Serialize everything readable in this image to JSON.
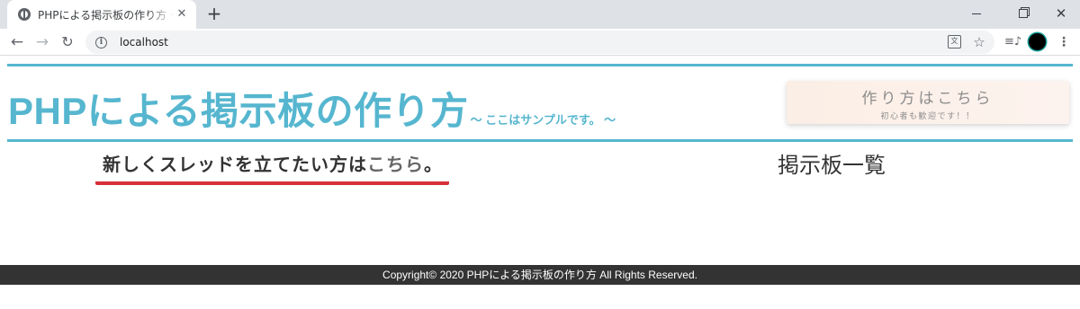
{
  "browser": {
    "tab": {
      "title": "PHPによる掲示板の作り方 ～ここはサ"
    },
    "address_bar": {
      "url": "localhost"
    },
    "colors": {
      "tabstrip": "#dee1e6",
      "profile_ring": "#1ba39c"
    }
  },
  "site": {
    "title": "PHPによる掲示板の作り方",
    "subtitle": "～ ここはサンプルです。 ～",
    "howto_title": "作り方はこちら",
    "howto_subtitle": "初心者も歓迎です！！",
    "new_thread_prefix": "新しくスレッドを立てたい方は",
    "new_thread_link": "こちら",
    "new_thread_suffix": "。",
    "board_list_title": "掲示板一覧",
    "footer": "Copyright© 2020 PHPによる掲示板の作り方 All Rights Reserved.",
    "colors": {
      "accent": "#56b6cf",
      "underline": "#d72e3a",
      "footer_bg": "#333333"
    }
  }
}
